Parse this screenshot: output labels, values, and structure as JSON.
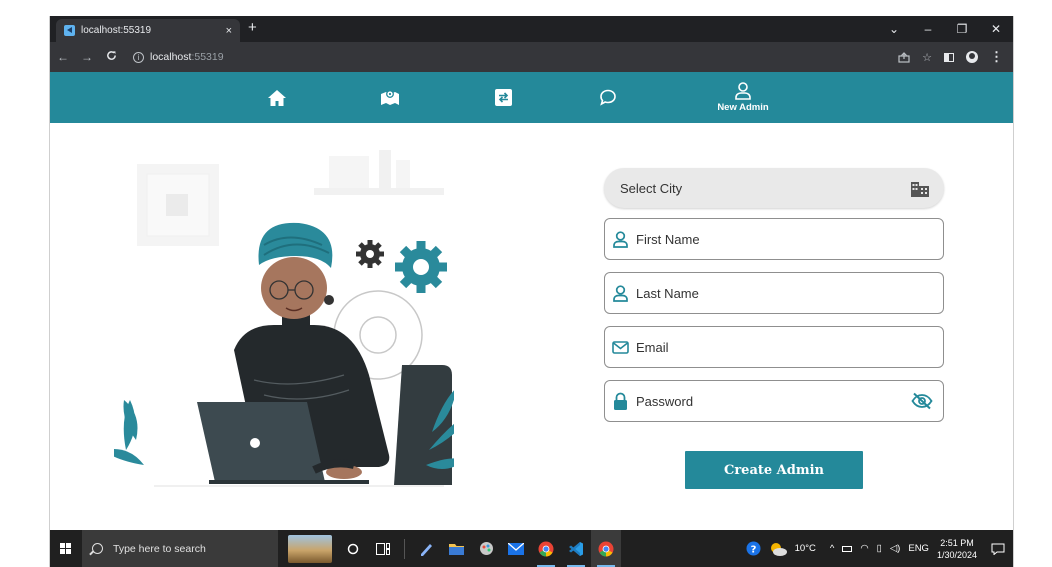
{
  "browser": {
    "tab_title": "localhost:55319",
    "tab_close": "×",
    "new_tab": "+",
    "url_host": "localhost",
    "url_port": ":55319",
    "window_controls": [
      "⌄",
      "–",
      "❐",
      "✕"
    ]
  },
  "navbar": {
    "items": [
      {
        "name": "home",
        "icon": "home-icon"
      },
      {
        "name": "map",
        "icon": "map-icon"
      },
      {
        "name": "transfer",
        "icon": "swap-icon"
      },
      {
        "name": "chat",
        "icon": "chat-icon"
      },
      {
        "name": "new-admin",
        "icon": "person-icon",
        "label": "New Admin"
      }
    ],
    "background": "#24899a"
  },
  "form": {
    "city_placeholder": "Select City",
    "first_name_placeholder": "First Name",
    "last_name_placeholder": "Last Name",
    "email_placeholder": "Email",
    "password_placeholder": "Password",
    "submit_label": "Create Admin"
  },
  "taskbar": {
    "search_placeholder": "Type here to search",
    "weather": "10°C",
    "language": "ENG",
    "time": "2:51 PM",
    "date": "1/30/2024"
  },
  "colors": {
    "accent": "#24899a",
    "illustration_teal": "#2a8a9b"
  }
}
